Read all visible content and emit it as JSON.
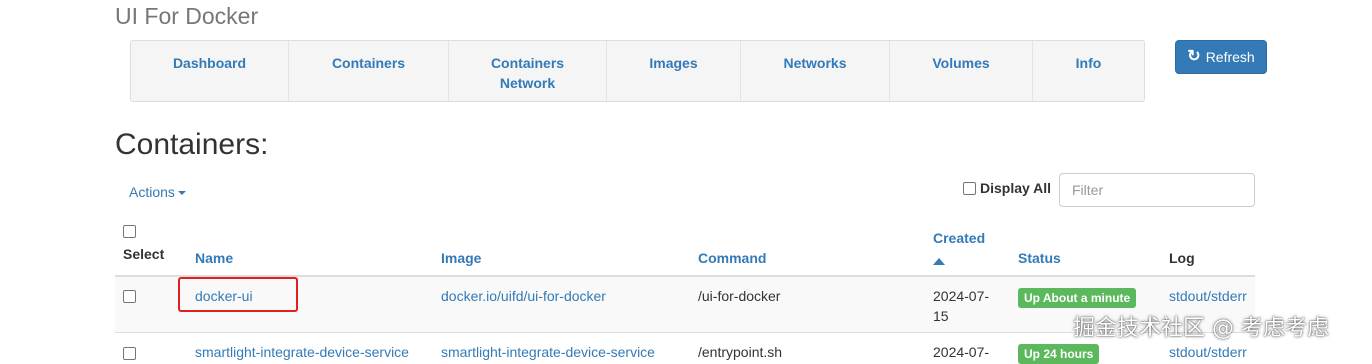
{
  "app": {
    "title": "UI For Docker"
  },
  "nav": {
    "items": [
      {
        "label": "Dashboard"
      },
      {
        "label": "Containers"
      },
      {
        "label": "Containers\nNetwork"
      },
      {
        "label": "Images"
      },
      {
        "label": "Networks"
      },
      {
        "label": "Volumes"
      },
      {
        "label": "Info"
      }
    ]
  },
  "refresh": {
    "label": "Refresh",
    "icon": "refresh-icon"
  },
  "page": {
    "heading": "Containers:"
  },
  "toolbar": {
    "actions_label": "Actions",
    "display_all_label": "Display All",
    "filter_placeholder": "Filter"
  },
  "table": {
    "headers": {
      "select": "Select",
      "name": "Name",
      "image": "Image",
      "command": "Command",
      "created": "Created",
      "status": "Status",
      "log": "Log"
    },
    "rows": [
      {
        "name": "docker-ui",
        "image": "docker.io/uifd/ui-for-docker",
        "command": "/ui-for-docker",
        "created": "2024-07-\n15",
        "status": "Up About a minute",
        "log": "stdout/stderr"
      },
      {
        "name": "smartlight-integrate-device-service",
        "image": "smartlight-integrate-device-service",
        "command": "/entrypoint.sh",
        "created": "2024-07-",
        "status": "Up 24 hours",
        "log": "stdout/stderr"
      }
    ]
  },
  "watermark": {
    "text": "掘金技术社区 @ 考虑考虑"
  },
  "colors": {
    "link": "#337ab7",
    "primary_button": "#337ab7",
    "success_badge": "#5cb85c",
    "highlight": "#e02020"
  }
}
